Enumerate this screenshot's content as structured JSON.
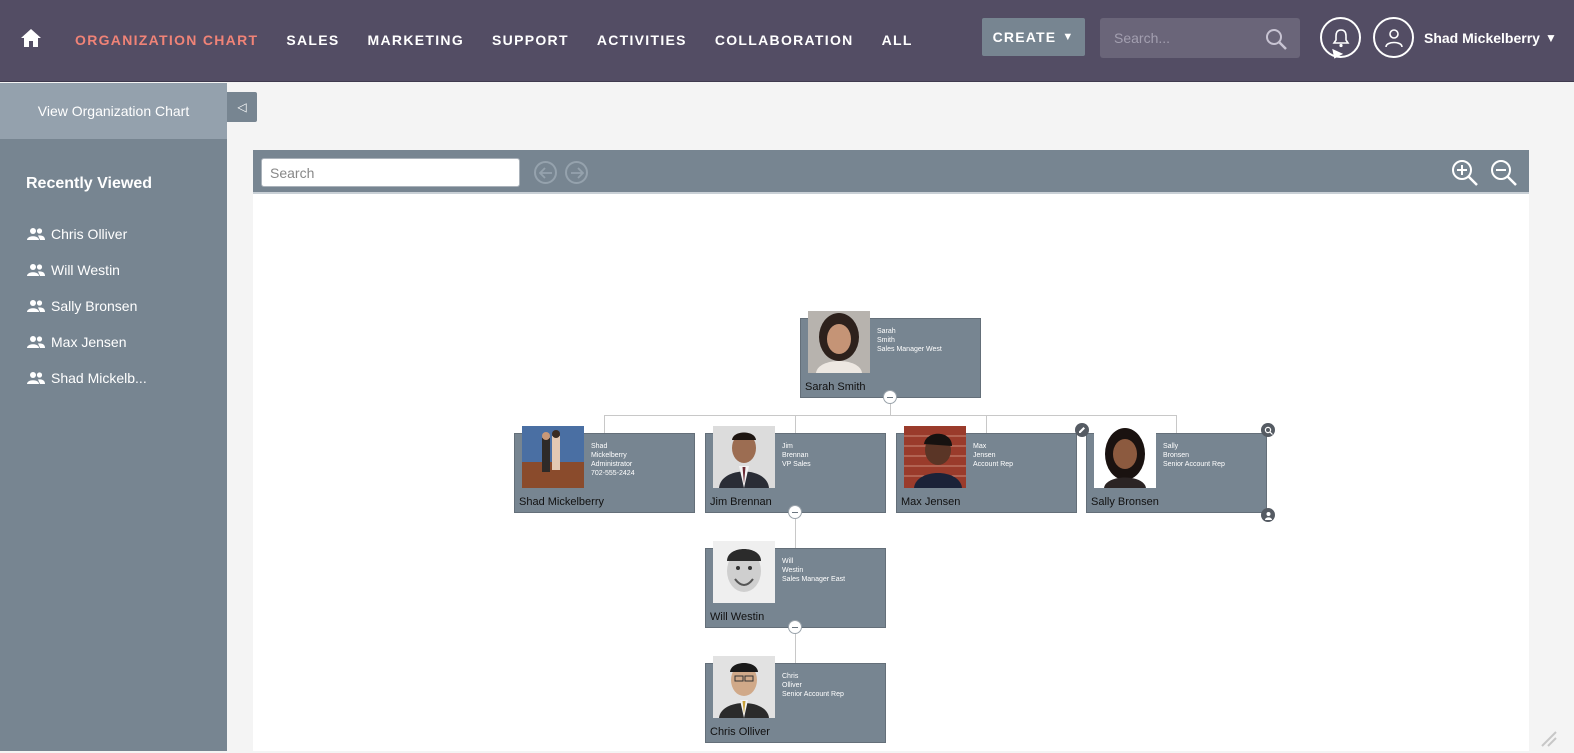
{
  "nav": {
    "items": [
      "ORGANIZATION CHART",
      "SALES",
      "MARKETING",
      "SUPPORT",
      "ACTIVITIES",
      "COLLABORATION",
      "ALL"
    ],
    "active_index": 0,
    "create_label": "CREATE",
    "search_placeholder": "Search...",
    "user_name": "Shad Mickelberry"
  },
  "sidebar": {
    "view_link": "View Organization Chart",
    "recently_viewed_title": "Recently Viewed",
    "recent": [
      "Chris Olliver",
      "Will Westin",
      "Sally Bronsen",
      "Max Jensen",
      "Shad Mickelb..."
    ]
  },
  "chart": {
    "search_placeholder": "Search",
    "nodes": [
      {
        "id": "sarah",
        "name": "Sarah Smith",
        "info": [
          "Sarah",
          "Smith",
          "Sales Manager West"
        ]
      },
      {
        "id": "shad",
        "name": "Shad Mickelberry",
        "info": [
          "Shad",
          "Mickelberry",
          "Administrator",
          "702-555-2424"
        ]
      },
      {
        "id": "jim",
        "name": "Jim Brennan",
        "info": [
          "Jim",
          "Brennan",
          "VP Sales"
        ]
      },
      {
        "id": "max",
        "name": "Max Jensen",
        "info": [
          "Max",
          "Jensen",
          "Account Rep"
        ]
      },
      {
        "id": "sally",
        "name": "Sally Bronsen",
        "info": [
          "Sally",
          "Bronsen",
          "Senior Account Rep"
        ]
      },
      {
        "id": "will",
        "name": "Will Westin",
        "info": [
          "Will",
          "Westin",
          "Sales Manager East"
        ]
      },
      {
        "id": "chris",
        "name": "Chris Olliver",
        "info": [
          "Chris",
          "Olliver",
          "Senior Account Rep"
        ]
      }
    ]
  },
  "colors": {
    "topbar": "#534d64",
    "accent": "#f08377",
    "sidebar": "#778591",
    "node": "#778591"
  },
  "icons": [
    "home-icon",
    "search-icon",
    "bell-icon",
    "user-icon",
    "users-icon",
    "zoom-in-icon",
    "zoom-out-icon",
    "arrow-left-icon",
    "arrow-right-icon",
    "edit-icon",
    "user-detail-icon",
    "resize-icon"
  ]
}
